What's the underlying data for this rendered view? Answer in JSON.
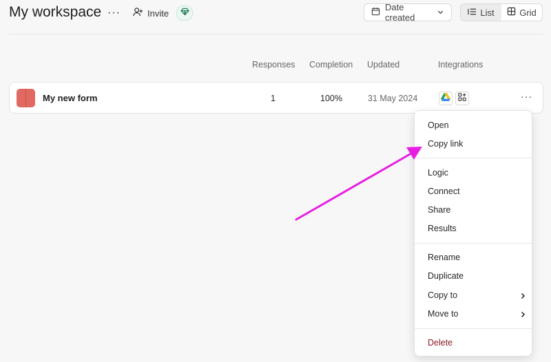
{
  "header": {
    "title": "My workspace",
    "more_label": "···",
    "invite_label": "Invite",
    "sort_label": "Date created",
    "view_list": "List",
    "view_grid": "Grid"
  },
  "table": {
    "columns": [
      "Responses",
      "Completion",
      "Updated",
      "Integrations"
    ],
    "rows": [
      {
        "name": "My new form",
        "responses": "1",
        "completion": "100%",
        "updated": "31 May 2024",
        "more": "···"
      }
    ]
  },
  "menu": {
    "items": [
      "Open",
      "Copy link",
      "Logic",
      "Connect",
      "Share",
      "Results",
      "Rename",
      "Duplicate",
      "Copy to",
      "Move to",
      "Delete"
    ]
  },
  "colors": {
    "accent_arrow": "#e61ee1",
    "form_icon": "#e06a62",
    "delete_text": "#8b1a23"
  },
  "icons": [
    "user-plus-icon",
    "diamond-icon",
    "calendar-icon",
    "chevron-down-icon",
    "list-icon",
    "grid-icon",
    "google-drive-icon",
    "add-app-icon",
    "chevron-right-icon"
  ]
}
